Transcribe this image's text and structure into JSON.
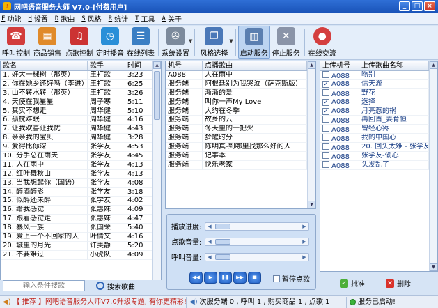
{
  "window": {
    "title": "网吧语音服务大师 V7.0-[付费用户]",
    "controls": [
      "_",
      "□",
      "×"
    ]
  },
  "menu": [
    {
      "key": "F",
      "label": "功能"
    },
    {
      "key": "H",
      "label": "设置"
    },
    {
      "key": "D",
      "label": "歌曲"
    },
    {
      "key": "S",
      "label": "风格"
    },
    {
      "key": "R",
      "label": "统计"
    },
    {
      "key": "T",
      "label": "工具"
    },
    {
      "key": "A",
      "label": "关于"
    }
  ],
  "toolbar": [
    {
      "label": "呼叫控制",
      "icon": "phone-icon",
      "color": "#d23c3c"
    },
    {
      "label": "商品销售",
      "icon": "shopping-icon",
      "color": "#e08a2a"
    },
    {
      "label": "点歌控制",
      "icon": "music-person-icon",
      "color": "#cc3333"
    },
    {
      "label": "定时播音",
      "icon": "clock-icon",
      "color": "#2a8fd8"
    },
    {
      "label": "在线列表",
      "icon": "online-list-icon",
      "color": "#3b7fc4"
    },
    {
      "label": "系统设置",
      "icon": "wrench-icon",
      "color": "#7c8a9c"
    },
    {
      "label": "风格选择",
      "icon": "style-icon",
      "color": "#4a78b8"
    },
    {
      "label": "启动服务",
      "icon": "start-service-icon",
      "color": "#5b7fb0"
    },
    {
      "label": "停止服务",
      "icon": "stop-service-icon",
      "color": "#8a94a8"
    },
    {
      "label": "在线交流",
      "icon": "chat-icon",
      "color": "#d43f3f"
    }
  ],
  "songs": {
    "headers": [
      "歌名",
      "歌手",
      "时间"
    ],
    "rows": [
      [
        "1. 好大一棵树（那英）",
        "王打歌",
        "3:23"
      ],
      [
        "2. 你在她乡还好吗（李进）",
        "王打歌",
        "6:25"
      ],
      [
        "3. 山不转水转（那英）",
        "王打歌",
        "3:26"
      ],
      [
        "4. 天使在我星星",
        "周子寒",
        "5:11"
      ],
      [
        "5. 其实不想走",
        "周华健",
        "5:10"
      ],
      [
        "6. 孤枕难眠",
        "周华健",
        "4:16"
      ],
      [
        "7. 让我欢喜让我忧",
        "周华健",
        "4:43"
      ],
      [
        "8. 亲亲我的宝贝",
        "周华健",
        "3:28"
      ],
      [
        "9. 爱得比你深",
        "张学友",
        "4:53"
      ],
      [
        "10. 分手总在雨天",
        "张学友",
        "4:45"
      ],
      [
        "11. 人在雨中",
        "张学友",
        "4:13"
      ],
      [
        "12. 红叶舞秋山",
        "张学友",
        "4:13"
      ],
      [
        "13. 当我想起你（国语）",
        "张学友",
        "4:08"
      ],
      [
        "14. 醉酒醉影",
        "张学友",
        "3:18"
      ],
      [
        "15. 似醉还未醉",
        "张学友",
        "4:02"
      ],
      [
        "16. 给我感觉",
        "张惠妹",
        "4:09"
      ],
      [
        "17. 跟着感觉走",
        "张惠妹",
        "4:47"
      ],
      [
        "18. 暴风一族",
        "张国荣",
        "5:40"
      ],
      [
        "19. 爱上一个不回家的人",
        "叶倩文",
        "4:16"
      ],
      [
        "20. 城里的月光",
        "许美静",
        "5:20"
      ],
      [
        "21. 不要难过",
        "小虎队",
        "4:09"
      ]
    ]
  },
  "requests": {
    "headers": [
      "机号",
      "点播歌曲"
    ],
    "rows": [
      [
        "A088",
        "人在雨中"
      ],
      [
        "服务端",
        "阿根廷别为我哭泣（萨克斯版）"
      ],
      [
        "服务端",
        "渐渐的爱"
      ],
      [
        "服务端",
        "叫你一声My Love"
      ],
      [
        "服务端",
        "大约在冬季"
      ],
      [
        "服务端",
        "故乡的云"
      ],
      [
        "服务端",
        "冬天里的一把火"
      ],
      [
        "服务端",
        "梦醒时分"
      ],
      [
        "服务端",
        "陈明真-到哪里找那么好的人"
      ],
      [
        "服务端",
        "记事本"
      ],
      [
        "服务端",
        "快乐老家"
      ]
    ]
  },
  "uploads": {
    "headers": [
      "上传机号",
      "上传歌曲名称"
    ],
    "rows": [
      {
        "checked": false,
        "id": "A088",
        "name": "吻别"
      },
      {
        "checked": true,
        "id": "A088",
        "name": "信天游"
      },
      {
        "checked": false,
        "id": "A088",
        "name": "野花"
      },
      {
        "checked": true,
        "id": "A088",
        "name": "选择"
      },
      {
        "checked": true,
        "id": "A088",
        "name": "月亮惹的祸"
      },
      {
        "checked": false,
        "id": "A088",
        "name": "再回首_姜育恒"
      },
      {
        "checked": false,
        "id": "A088",
        "name": "曾经心疼"
      },
      {
        "checked": false,
        "id": "A088",
        "name": "我的中国心"
      },
      {
        "checked": false,
        "id": "A088",
        "name": "20. 回头太难 - 张学友"
      },
      {
        "checked": false,
        "id": "A088",
        "name": "张学友-偷心"
      },
      {
        "checked": false,
        "id": "A088",
        "name": "头发乱了"
      }
    ],
    "approve_label": "批准",
    "delete_label": "删除"
  },
  "search": {
    "placeholder": "输入条件搜歌",
    "button_label": "搜索歌曲"
  },
  "controls": {
    "playback_label": "播放进度:",
    "request_volume_label": "点歌音量:",
    "call_volume_label": "呼叫音量:",
    "pause_label": "暂停点歌",
    "player_buttons": [
      "◀◀",
      "▶",
      "❚❚",
      "▶▶",
      "■"
    ]
  },
  "status": {
    "promo": "【 推荐 】网吧语音服务大师V7.0升级专题, 有你更精彩!",
    "counts": "次服务端 0 , 呼叫 1 , 购买商品 1 , 点歌 1",
    "service": "服务已启动!"
  }
}
